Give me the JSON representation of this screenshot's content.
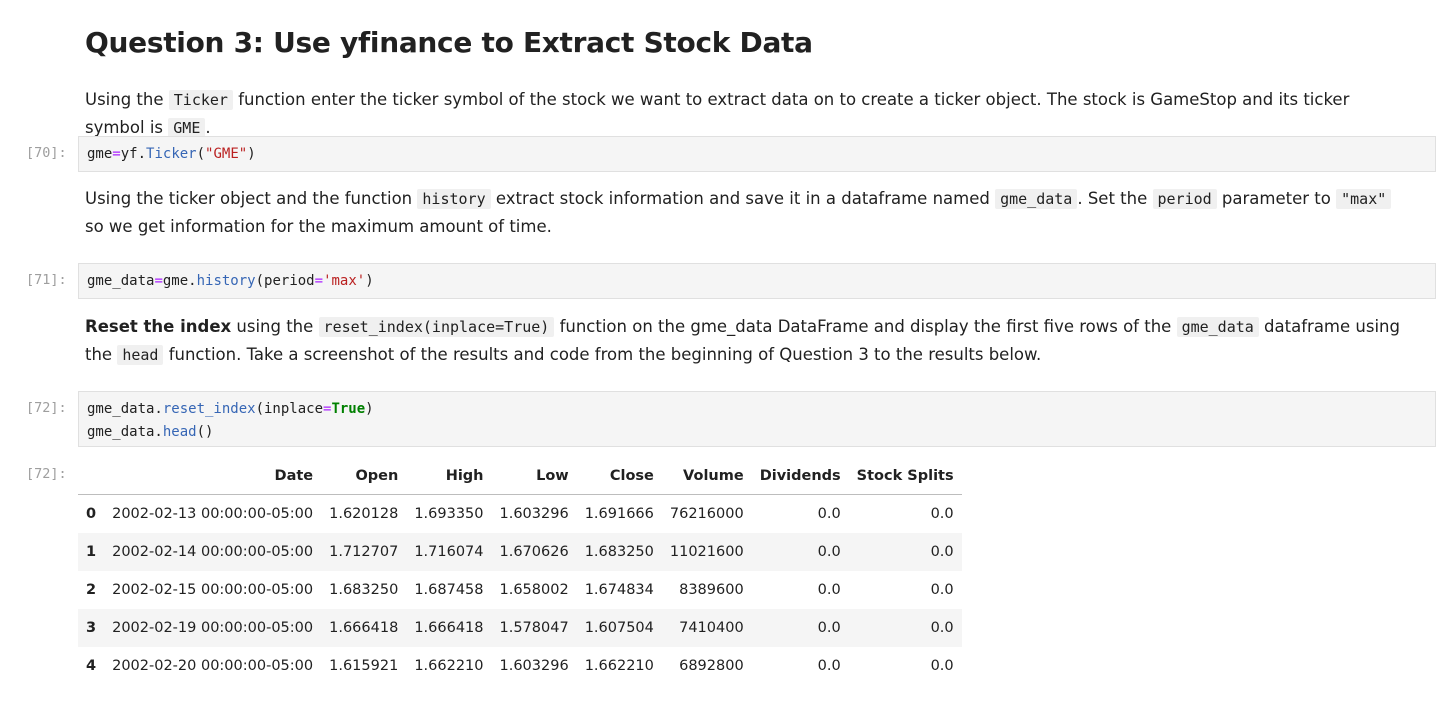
{
  "heading": "Question 3: Use yfinance to Extract Stock Data",
  "md1": {
    "t1": "Using the ",
    "c1": "Ticker",
    "t2": " function enter the ticker symbol of the stock we want to extract data on to create a ticker object. The stock is GameStop and its ticker symbol is ",
    "c2": "GME",
    "t3": "."
  },
  "cell70": {
    "prompt": "[70]:",
    "v": "gme",
    "eq": "=",
    "obj": "yf.",
    "fn": "Ticker",
    "p1": "(",
    "str": "\"GME\"",
    "p2": ")"
  },
  "md2": {
    "t1": "Using the ticker object and the function ",
    "c1": "history",
    "t2": " extract stock information and save it in a dataframe named ",
    "c2": "gme_data",
    "t3": ". Set the ",
    "c3": "period",
    "t4": " parameter to ",
    "c4": "\"max\"",
    "t5": " so we get information for the maximum amount of time."
  },
  "cell71": {
    "prompt": "[71]:",
    "v": "gme_data",
    "eq": "=",
    "obj": "gme.",
    "fn": "history",
    "p1": "(period",
    "eq2": "=",
    "str": "'max'",
    "p2": ")"
  },
  "md3": {
    "b1": "Reset the index",
    "t1": " using the ",
    "c1": "reset_index(inplace=True)",
    "t2": " function on the gme_data DataFrame and display the first five rows of the ",
    "c2": "gme_data",
    "t3": " dataframe using the ",
    "c3": "head",
    "t4": " function. Take a screenshot of the results and code from the beginning of Question 3 to the results below."
  },
  "cell72": {
    "prompt": "[72]:",
    "l1_obj": "gme_data.",
    "l1_fn": "reset_index",
    "l1_p1": "(inplace",
    "l1_eq": "=",
    "l1_kw": "True",
    "l1_p2": ")",
    "l2_obj": "gme_data.",
    "l2_fn": "head",
    "l2_p": "()"
  },
  "output72": {
    "prompt": "[72]:",
    "columns": [
      "",
      "Date",
      "Open",
      "High",
      "Low",
      "Close",
      "Volume",
      "Dividends",
      "Stock Splits"
    ],
    "rows": [
      [
        "0",
        "2002-02-13 00:00:00-05:00",
        "1.620128",
        "1.693350",
        "1.603296",
        "1.691666",
        "76216000",
        "0.0",
        "0.0"
      ],
      [
        "1",
        "2002-02-14 00:00:00-05:00",
        "1.712707",
        "1.716074",
        "1.670626",
        "1.683250",
        "11021600",
        "0.0",
        "0.0"
      ],
      [
        "2",
        "2002-02-15 00:00:00-05:00",
        "1.683250",
        "1.687458",
        "1.658002",
        "1.674834",
        "8389600",
        "0.0",
        "0.0"
      ],
      [
        "3",
        "2002-02-19 00:00:00-05:00",
        "1.666418",
        "1.666418",
        "1.578047",
        "1.607504",
        "7410400",
        "0.0",
        "0.0"
      ],
      [
        "4",
        "2002-02-20 00:00:00-05:00",
        "1.615921",
        "1.662210",
        "1.603296",
        "1.662210",
        "6892800",
        "0.0",
        "0.0"
      ]
    ]
  }
}
